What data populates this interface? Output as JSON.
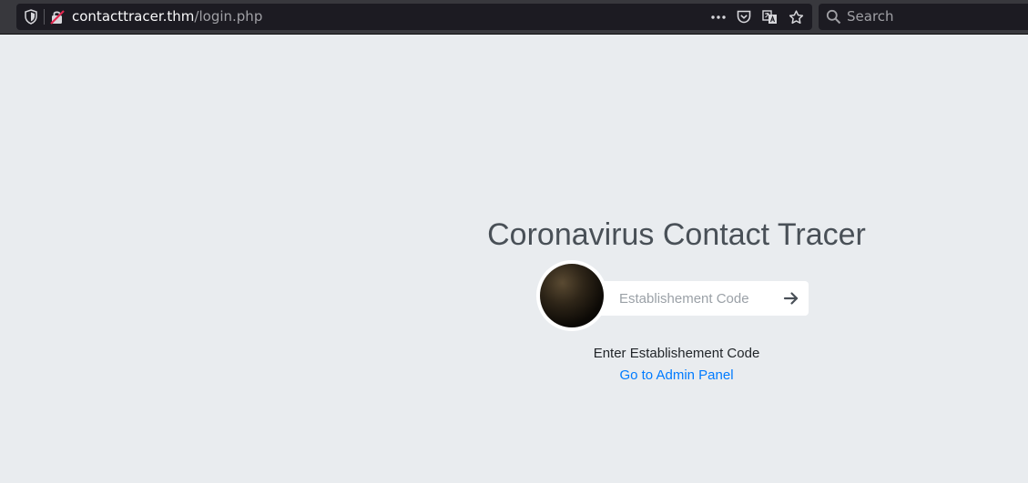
{
  "browser": {
    "url_host": "contacttracer.thm",
    "url_path": "/login.php",
    "search_placeholder": "Search",
    "icons": [
      "shield-icon",
      "insecure-lock-icon",
      "more-actions-icon",
      "pocket-icon",
      "translate-icon",
      "bookmark-star-icon",
      "search-icon"
    ]
  },
  "page": {
    "title": "Coronavirus Contact Tracer",
    "code_placeholder": "Establishement Code",
    "hint": "Enter Establishement Code",
    "admin_link": "Go to Admin Panel",
    "colors": {
      "background": "#e9ecef",
      "link": "#007bff",
      "title": "#495057"
    }
  }
}
